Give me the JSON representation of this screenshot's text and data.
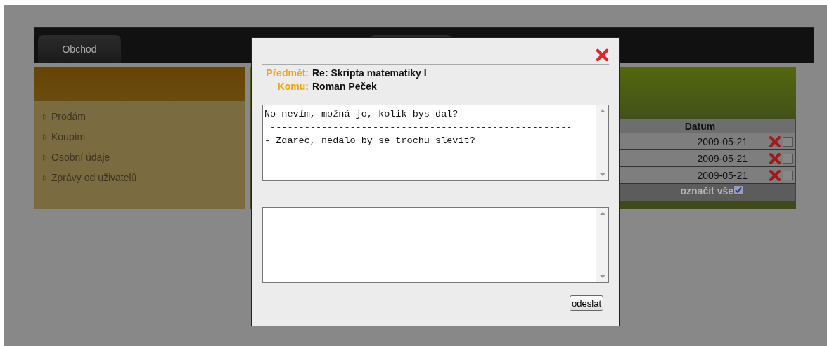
{
  "tabs": [
    {
      "label": "Obchod"
    }
  ],
  "sidebar": {
    "items": [
      {
        "label": "Prodám"
      },
      {
        "label": "Koupím"
      },
      {
        "label": "Osobní údaje"
      },
      {
        "label": "Zprávy od uživatelů"
      }
    ]
  },
  "messages": {
    "columns": [
      "Datum"
    ],
    "rows": [
      {
        "date": "2009-05-21",
        "checked": false
      },
      {
        "date": "2009-05-21",
        "checked": false
      },
      {
        "date": "2009-05-21",
        "checked": false
      }
    ],
    "select_all": {
      "label": "označit vše",
      "checked": true
    }
  },
  "dialog": {
    "subject_label": "Předmět:",
    "subject": "Re: Skripta matematiky I",
    "to_label": "Komu:",
    "to": "Roman Peček",
    "message": "No nevím, možná jo, kolik bys dal?\n -----------------------------------------------------\n- Zdarec, nedalo by se trochu slevit?",
    "send_button": "odeslat"
  }
}
